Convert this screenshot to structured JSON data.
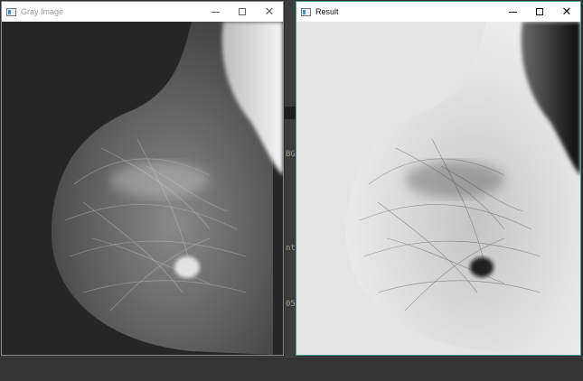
{
  "windows": {
    "gray": {
      "title": "Gray Image",
      "image": "grayscale mammogram",
      "icons": {
        "app": "window-app-icon",
        "minimize": "minimize-icon",
        "maximize": "maximize-icon",
        "close": "close-icon"
      }
    },
    "result": {
      "title": "Result",
      "image": "inverted enhanced mammogram",
      "icons": {
        "app": "window-app-icon",
        "minimize": "minimize-icon",
        "maximize": "maximize-icon",
        "close": "close-icon"
      }
    }
  },
  "background": {
    "fragments": [
      "BG",
      "nt",
      "05"
    ]
  },
  "colors": {
    "result_border": "#4a9a9a",
    "gray_border": "#8a8a8a"
  }
}
